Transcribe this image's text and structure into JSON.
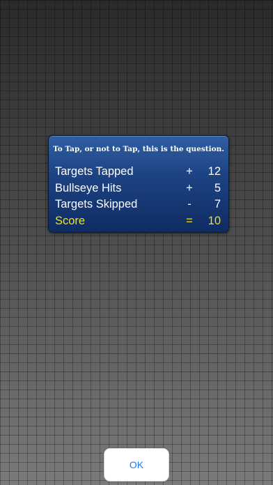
{
  "dialog": {
    "title": "To Tap, or not to Tap, this is the question.",
    "rows": [
      {
        "label": "Targets Tapped",
        "operator": "+",
        "value": "12"
      },
      {
        "label": "Bullseye Hits",
        "operator": "+",
        "value": "5"
      },
      {
        "label": "Targets Skipped",
        "operator": "-",
        "value": "7"
      },
      {
        "label": "Score",
        "operator": "=",
        "value": "10"
      }
    ]
  },
  "ok_button": {
    "label": "OK"
  },
  "colors": {
    "panel": "#1d4384",
    "score_highlight": "#f3e018",
    "button_text": "#1a7af2",
    "background": "#5c5c5c"
  }
}
